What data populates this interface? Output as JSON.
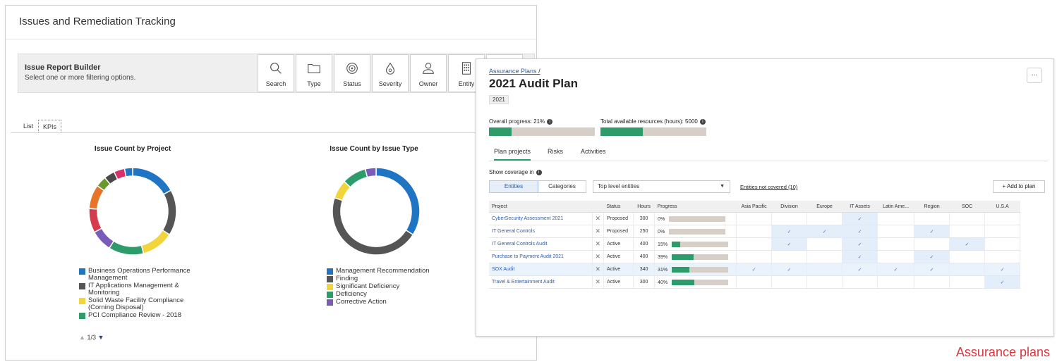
{
  "left": {
    "title": "Issues and Remediation Tracking",
    "builder": {
      "title": "Issue Report Builder",
      "subtitle": "Select one or more filtering options.",
      "buttons": [
        {
          "label": "Search",
          "icon": "search-icon"
        },
        {
          "label": "Type",
          "icon": "folder-icon"
        },
        {
          "label": "Status",
          "icon": "target-icon"
        },
        {
          "label": "Severity",
          "icon": "drop-icon"
        },
        {
          "label": "Owner",
          "icon": "person-icon"
        },
        {
          "label": "Entity",
          "icon": "building-icon"
        }
      ]
    },
    "tabs": [
      "List",
      "KPIs"
    ],
    "pager": {
      "text": "1/3"
    },
    "charts": [
      {
        "title": "Issue Count by Project",
        "legend": [
          {
            "label": "Business Operations Performance Management",
            "color": "#1f74c4"
          },
          {
            "label": "IT Applications Management & Monitoring",
            "color": "#555555"
          },
          {
            "label": "Solid Waste Facility Compliance (Corning Disposal)",
            "color": "#f2d43b"
          },
          {
            "label": "PCI Compliance Review - 2018",
            "color": "#2e9b6a"
          }
        ]
      },
      {
        "title": "Issue Count by Issue Type",
        "legend": [
          {
            "label": "Management Recommendation",
            "color": "#1f74c4"
          },
          {
            "label": "Finding",
            "color": "#555555"
          },
          {
            "label": "Significant Deficiency",
            "color": "#f2d43b"
          },
          {
            "label": "Deficiency",
            "color": "#2e9b6a"
          },
          {
            "label": "Corrective Action",
            "color": "#7a5cb8"
          }
        ]
      }
    ]
  },
  "chart_data": [
    {
      "type": "pie",
      "title": "Issue Count by Project",
      "donut": true,
      "slices": [
        {
          "label": "Business Operations Performance Management",
          "value": 17,
          "color": "#1f74c4"
        },
        {
          "label": "IT Applications Management & Monitoring",
          "value": 17,
          "color": "#555555"
        },
        {
          "label": "Solid Waste Facility Compliance (Corning Disposal)",
          "value": 12,
          "color": "#f2d43b"
        },
        {
          "label": "PCI Compliance Review - 2018",
          "value": 13,
          "color": "#2e9b6a"
        },
        {
          "label": "",
          "value": 8,
          "color": "#7a5cb8"
        },
        {
          "label": "",
          "value": 9,
          "color": "#d43b4c"
        },
        {
          "label": "",
          "value": 9,
          "color": "#e8742a"
        },
        {
          "label": "",
          "value": 4,
          "color": "#6a9a2e"
        },
        {
          "label": "",
          "value": 4,
          "color": "#4a4a4a"
        },
        {
          "label": "",
          "value": 4,
          "color": "#d8306c"
        },
        {
          "label": "",
          "value": 3,
          "color": "#1f74c4"
        }
      ]
    },
    {
      "type": "pie",
      "title": "Issue Count by Issue Type",
      "donut": true,
      "slices": [
        {
          "label": "Management Recommendation",
          "value": 34,
          "color": "#1f74c4"
        },
        {
          "label": "Finding",
          "value": 46,
          "color": "#555555"
        },
        {
          "label": "Significant Deficiency",
          "value": 7,
          "color": "#f2d43b"
        },
        {
          "label": "Deficiency",
          "value": 9,
          "color": "#2e9b6a"
        },
        {
          "label": "Corrective Action",
          "value": 4,
          "color": "#7a5cb8"
        }
      ]
    }
  ],
  "right": {
    "breadcrumb": "Assurance Plans",
    "breadcrumb_sep": "/",
    "title": "2021 Audit Plan",
    "year": "2021",
    "more": "...",
    "overall_label": "Overall progress: 21%",
    "overall_value": 0.21,
    "resources_label": "Total available resources (hours): 5000",
    "resources_value": 0.4,
    "tabs": [
      "Plan projects",
      "Risks",
      "Activities"
    ],
    "coverage_label": "Show coverage in",
    "seg": [
      "Entities",
      "Categories"
    ],
    "select_value": "Top level entities",
    "not_covered": "Entities not covered (10)",
    "add_button": "+ Add to plan",
    "columns": [
      "Project",
      "Status",
      "Hours",
      "Progress",
      "Asia Pacific",
      "Division",
      "Europe",
      "IT Assets",
      "Latin Ame...",
      "Region",
      "SOC",
      "U.S.A"
    ],
    "rows": [
      {
        "project": "CyberSecurity Assessment 2021",
        "status": "Proposed",
        "hours": "300",
        "progress_label": "0%",
        "progress": 0,
        "cov": [
          false,
          false,
          false,
          true,
          false,
          false,
          false,
          false
        ],
        "hl": false
      },
      {
        "project": "IT General Controls",
        "status": "Proposed",
        "hours": "250",
        "progress_label": "0%",
        "progress": 0,
        "cov": [
          false,
          true,
          true,
          true,
          false,
          true,
          false,
          false
        ],
        "hl": false
      },
      {
        "project": "IT General Controls Audit",
        "status": "Active",
        "hours": "400",
        "progress_label": "15%",
        "progress": 0.15,
        "cov": [
          false,
          true,
          false,
          true,
          false,
          false,
          true,
          false
        ],
        "hl": false
      },
      {
        "project": "Purchase to Payment Audit 2021",
        "status": "Active",
        "hours": "400",
        "progress_label": "39%",
        "progress": 0.39,
        "cov": [
          false,
          false,
          false,
          true,
          false,
          true,
          false,
          false
        ],
        "hl": false
      },
      {
        "project": "SOX Audit",
        "status": "Active",
        "hours": "340",
        "progress_label": "31%",
        "progress": 0.31,
        "cov": [
          true,
          true,
          false,
          true,
          true,
          true,
          false,
          true
        ],
        "hl": true
      },
      {
        "project": "Travel & Entertainment Audit",
        "status": "Active",
        "hours": "300",
        "progress_label": "40%",
        "progress": 0.4,
        "cov": [
          false,
          false,
          false,
          false,
          false,
          false,
          false,
          true
        ],
        "hl": false
      }
    ],
    "check": "✓",
    "remove": "✕"
  },
  "caption": "Assurance plans"
}
